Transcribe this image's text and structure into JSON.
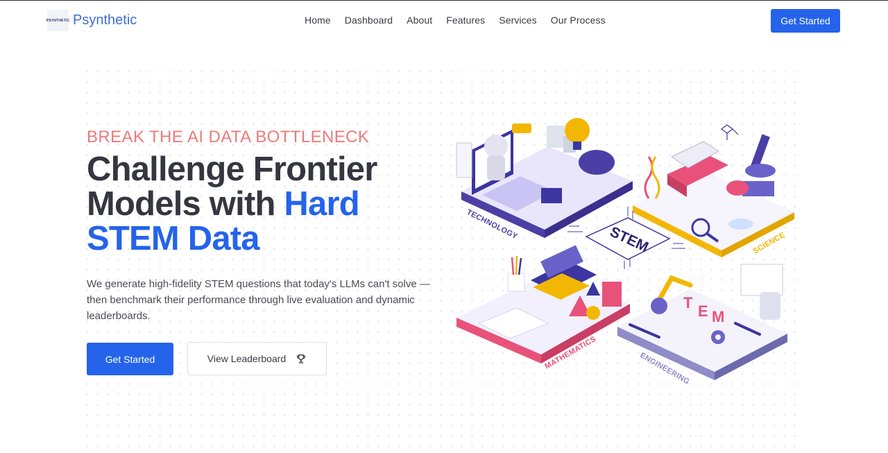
{
  "nav": {
    "logo_text": "PSYNTHETIC",
    "brand": "Psynthetic",
    "items": [
      "Home",
      "Dashboard",
      "About",
      "Features",
      "Services",
      "Our Process"
    ],
    "cta": "Get Started"
  },
  "hero": {
    "eyebrow": "BREAK THE AI DATA BOTTLENECK",
    "headline_part1": "Challenge Frontier Models with ",
    "headline_accent": "Hard STEM Data",
    "description": "We generate high-fidelity STEM questions that today's LLMs can't solve — then benchmark their performance through live evaluation and dynamic leaderboards.",
    "primary_button": "Get Started",
    "secondary_button": "View Leaderboard"
  },
  "illustration": {
    "center": "STEM",
    "labels": {
      "technology": "TECHNOLOGY",
      "science": "SCIENCE",
      "mathematics": "MATHEMATICS",
      "engineering": "ENGINEERING"
    },
    "blocks": [
      "T",
      "E",
      "M"
    ],
    "colors": {
      "technology": "#4b3fa6",
      "science": "#f2b705",
      "mathematics": "#e8527a",
      "engineering": "#8f8cc8",
      "accent": "#2563eb",
      "brand": "#3c6fd6",
      "eyebrow": "#ee7a7a"
    }
  }
}
